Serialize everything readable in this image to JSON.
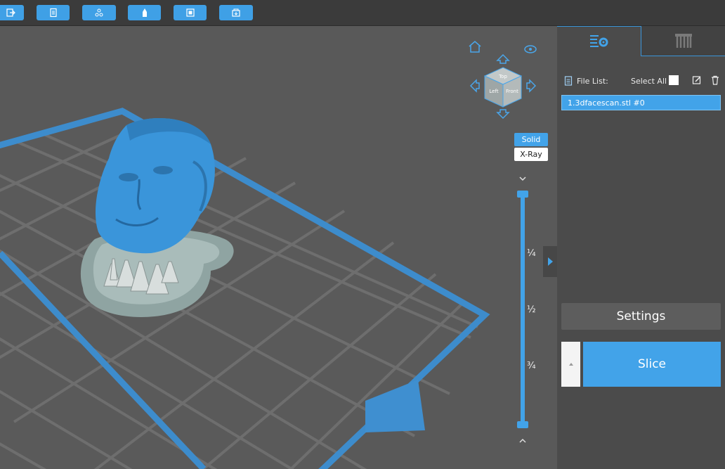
{
  "toolbar": {
    "buttons": [
      {
        "icon": "import-icon"
      },
      {
        "icon": "file-icon"
      },
      {
        "icon": "tree-icon"
      },
      {
        "icon": "support-icon"
      },
      {
        "icon": "resize-icon"
      },
      {
        "icon": "export-icon"
      }
    ]
  },
  "view": {
    "cube_faces": {
      "top": "Top",
      "left": "Left",
      "front": "Front"
    },
    "mode_solid": "Solid",
    "mode_xray": "X-Ray",
    "slider_fracs": [
      "¼",
      "½",
      "¾"
    ]
  },
  "panel": {
    "file_list_label": "File List:",
    "select_all_label": "Select All",
    "files": [
      "1.3dfacescan.stl #0"
    ],
    "settings_label": "Settings",
    "slice_label": "Slice",
    "slice_option_icon": "expand-up-icon"
  },
  "colors": {
    "accent": "#42a3e9",
    "background": "#595959",
    "panel": "#4b4b4b",
    "annotation_arrow": "#e4212b"
  }
}
